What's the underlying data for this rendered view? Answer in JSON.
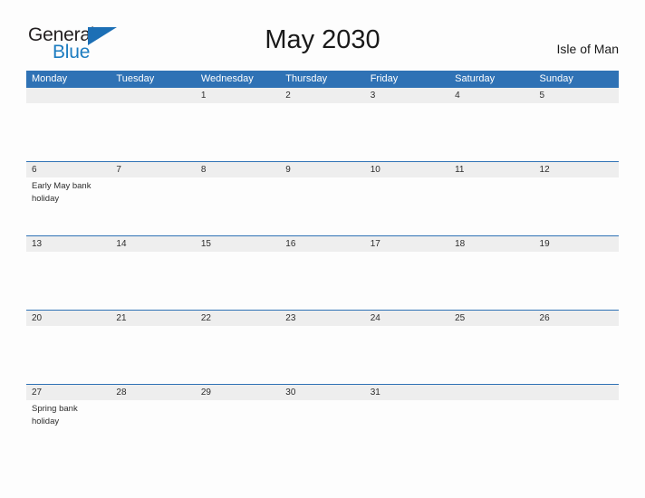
{
  "brand": {
    "name_part1": "General",
    "name_part2": "Blue",
    "flag_icon": "triangle-flag-icon"
  },
  "header": {
    "title": "May 2030",
    "location": "Isle of Man"
  },
  "colors": {
    "header_blue": "#2f72b5",
    "brand_blue": "#1c7cc0",
    "row_band": "#eeeeee",
    "text": "#2d2d2d",
    "page_background": "#fdfdfd"
  },
  "calendar": {
    "weekdays": [
      "Monday",
      "Tuesday",
      "Wednesday",
      "Thursday",
      "Friday",
      "Saturday",
      "Sunday"
    ],
    "weeks": [
      [
        {
          "day": "",
          "events": []
        },
        {
          "day": "",
          "events": []
        },
        {
          "day": "1",
          "events": []
        },
        {
          "day": "2",
          "events": []
        },
        {
          "day": "3",
          "events": []
        },
        {
          "day": "4",
          "events": []
        },
        {
          "day": "5",
          "events": []
        }
      ],
      [
        {
          "day": "6",
          "events": [
            "Early May bank holiday"
          ]
        },
        {
          "day": "7",
          "events": []
        },
        {
          "day": "8",
          "events": []
        },
        {
          "day": "9",
          "events": []
        },
        {
          "day": "10",
          "events": []
        },
        {
          "day": "11",
          "events": []
        },
        {
          "day": "12",
          "events": []
        }
      ],
      [
        {
          "day": "13",
          "events": []
        },
        {
          "day": "14",
          "events": []
        },
        {
          "day": "15",
          "events": []
        },
        {
          "day": "16",
          "events": []
        },
        {
          "day": "17",
          "events": []
        },
        {
          "day": "18",
          "events": []
        },
        {
          "day": "19",
          "events": []
        }
      ],
      [
        {
          "day": "20",
          "events": []
        },
        {
          "day": "21",
          "events": []
        },
        {
          "day": "22",
          "events": []
        },
        {
          "day": "23",
          "events": []
        },
        {
          "day": "24",
          "events": []
        },
        {
          "day": "25",
          "events": []
        },
        {
          "day": "26",
          "events": []
        }
      ],
      [
        {
          "day": "27",
          "events": [
            "Spring bank holiday"
          ]
        },
        {
          "day": "28",
          "events": []
        },
        {
          "day": "29",
          "events": []
        },
        {
          "day": "30",
          "events": []
        },
        {
          "day": "31",
          "events": []
        },
        {
          "day": "",
          "events": []
        },
        {
          "day": "",
          "events": []
        }
      ]
    ]
  }
}
